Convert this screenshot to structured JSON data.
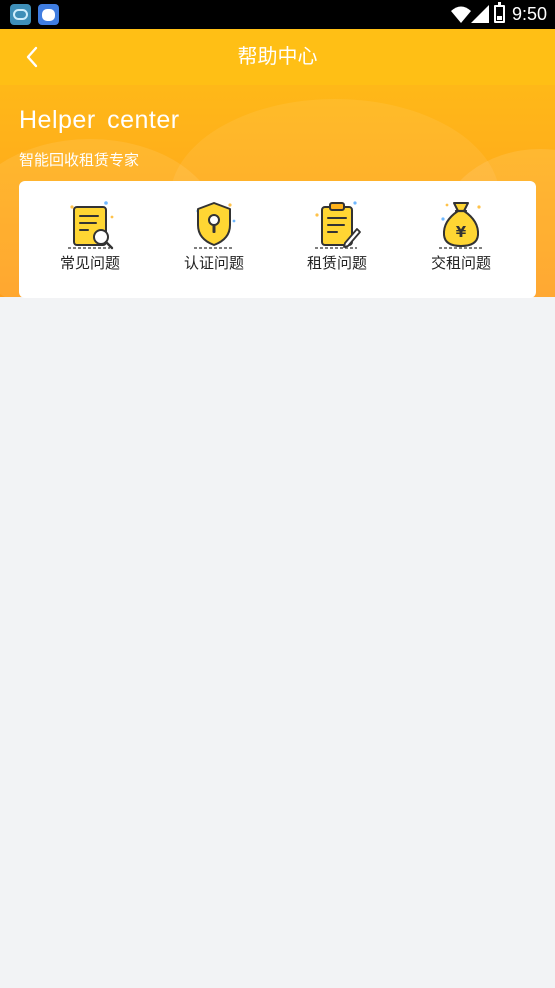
{
  "status_bar": {
    "time": "9:50",
    "icons": [
      "app-icon",
      "baidu-app-icon",
      "wifi-icon",
      "signal-icon",
      "battery-icon"
    ]
  },
  "nav": {
    "back_icon": "chevron-left-icon",
    "title": "帮助中心"
  },
  "hero": {
    "title": "Helper  center",
    "subtitle": "智能回收租赁专家"
  },
  "categories": [
    {
      "label": "常见问题",
      "icon": "document-search-icon"
    },
    {
      "label": "认证问题",
      "icon": "shield-keyhole-icon"
    },
    {
      "label": "租赁问题",
      "icon": "clipboard-edit-icon"
    },
    {
      "label": "交租问题",
      "icon": "money-bag-yen-icon"
    }
  ],
  "colors": {
    "brand_yellow": "#ffbf15",
    "brand_orange": "#ff9f1c",
    "icon_yellow": "#ffd633",
    "icon_outline": "#333333",
    "page_bg": "#f2f3f5"
  }
}
